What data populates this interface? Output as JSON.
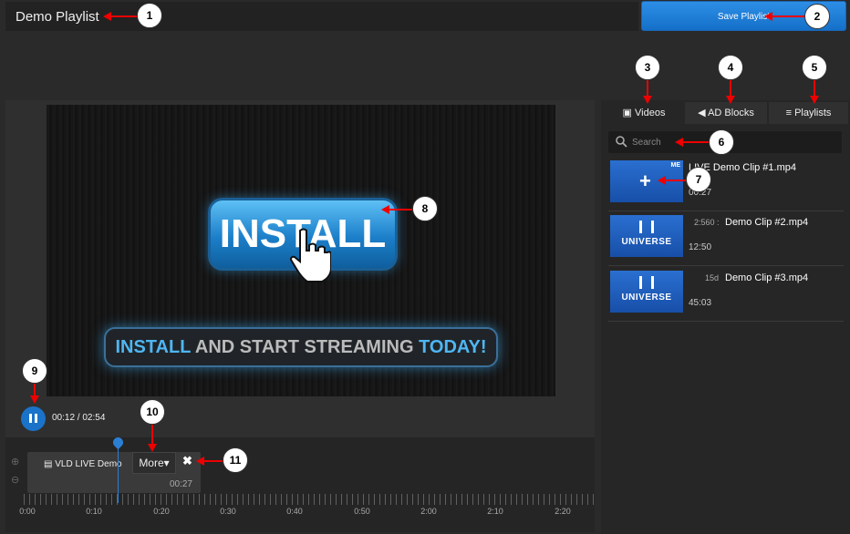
{
  "header": {
    "title": "Demo Playlist",
    "save_label": "Save Playlist"
  },
  "player": {
    "install_text": "INSTALL",
    "banner_part1": "INSTALL",
    "banner_part2": " AND START STREAMING ",
    "banner_part3": "TODAY!",
    "time": "00:12 / 02:54"
  },
  "timeline": {
    "clip_label": "LIVE Demo",
    "clip_prefix": "VLD",
    "clip_duration": "00:27",
    "more_label": "More",
    "ticks": [
      "0:00",
      "0:10",
      "0:20",
      "0:30",
      "0:40",
      "0:50",
      "2:00",
      "2:10",
      "2:20"
    ]
  },
  "tabs": [
    {
      "label": "Videos"
    },
    {
      "label": "AD Blocks"
    },
    {
      "label": "Playlists"
    }
  ],
  "search": {
    "placeholder": "Search"
  },
  "videos": [
    {
      "name": "LIVE Demo Clip #1.mp4",
      "res": "",
      "duration": "00:27",
      "badge": "ME"
    },
    {
      "name": "Demo Clip #2.mp4",
      "res": "2:560 :",
      "duration": "12:50",
      "thumb_text": "UNIVERSE"
    },
    {
      "name": "Demo Clip #3.mp4",
      "res": "15d",
      "duration": "45:03",
      "thumb_text": "UNIVERSE"
    }
  ],
  "callouts": [
    "1",
    "2",
    "3",
    "4",
    "5",
    "6",
    "7",
    "8",
    "9",
    "10",
    "11"
  ],
  "colors": {
    "accent": "#1a73c8",
    "arrow": "#e00000"
  }
}
